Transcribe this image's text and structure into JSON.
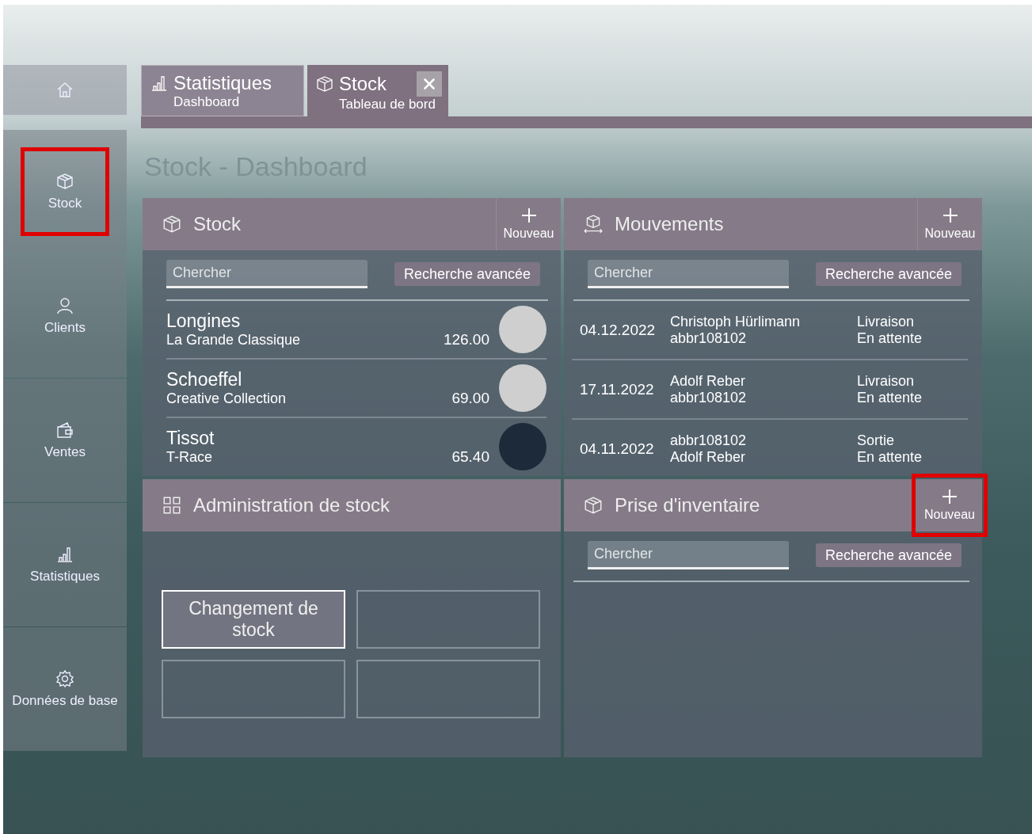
{
  "sidebar": {
    "items": [
      {
        "kind": "home",
        "highlighted": false
      },
      {
        "kind": "stock",
        "label": "Stock",
        "highlighted": true
      },
      {
        "kind": "clients",
        "label": "Clients",
        "highlighted": false
      },
      {
        "kind": "sales",
        "label": "Ventes",
        "highlighted": false
      },
      {
        "kind": "stats",
        "label": "Statistiques",
        "highlighted": false
      },
      {
        "kind": "settings",
        "label": "Données de base",
        "highlighted": false
      }
    ]
  },
  "tabs": [
    {
      "kind": "stats",
      "title": "Statistiques",
      "subtitle": "Dashboard",
      "selected": false,
      "closable": false
    },
    {
      "kind": "stock",
      "title": "Stock",
      "subtitle": "Tableau de bord",
      "selected": true,
      "closable": true
    }
  ],
  "page_title": "Stock - Dashboard",
  "panels": [
    {
      "kind": "products",
      "title": "Stock",
      "new_label": "Nouveau",
      "new_highlighted": false,
      "search": {
        "placeholder": "Chercher"
      },
      "advanced_label": "Recherche avancée",
      "rows": [
        {
          "brand": "Longines",
          "model": "La Grande Classique",
          "price": "126.00"
        },
        {
          "brand": "Schoeffel",
          "model": "Creative Collection",
          "price": "69.00"
        },
        {
          "brand": "Tissot",
          "model": "T-Race",
          "price": "65.40"
        }
      ]
    },
    {
      "kind": "movements",
      "title": "Mouvements",
      "new_label": "Nouveau",
      "new_highlighted": false,
      "search": {
        "placeholder": "Chercher"
      },
      "advanced_label": "Recherche avancée",
      "rows": [
        {
          "date": "04.12.2022",
          "party_1": "Christoph Hürlimann",
          "party_2": "abbr108102",
          "type": "Livraison",
          "status": "En attente"
        },
        {
          "date": "17.11.2022",
          "party_1": "Adolf Reber",
          "party_2": "abbr108102",
          "type": "Livraison",
          "status": "En attente"
        },
        {
          "date": "04.11.2022",
          "party_1": "abbr108102",
          "party_2": "Adolf Reber",
          "type": "Sortie",
          "status": "En attente"
        }
      ]
    },
    {
      "kind": "tiles",
      "title": "Administration de stock",
      "tiles": [
        "Changement de stock"
      ]
    },
    {
      "kind": "inventory",
      "title": "Prise d'inventaire",
      "new_label": "Nouveau",
      "new_highlighted": true,
      "search": {
        "placeholder": "Chercher"
      },
      "advanced_label": "Recherche avancée"
    }
  ]
}
